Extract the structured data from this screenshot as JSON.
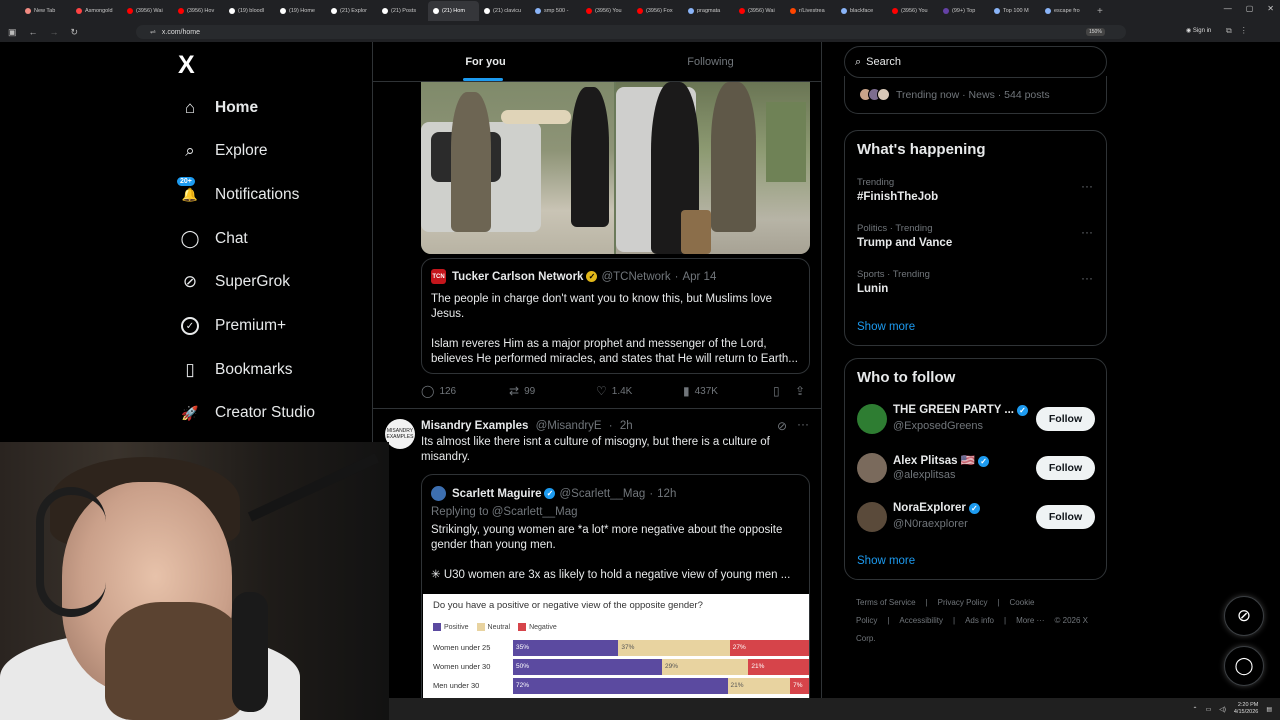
{
  "browser": {
    "tabs": [
      {
        "label": "New Tab",
        "color": "#f28b82"
      },
      {
        "label": "Asmongold",
        "color": "#ff4444"
      },
      {
        "label": "(3956) Wai",
        "color": "#ff0000"
      },
      {
        "label": "(3956) Hov",
        "color": "#ff0000"
      },
      {
        "label": "(19) bloodl",
        "color": "#ffffff"
      },
      {
        "label": "(19) Home",
        "color": "#ffffff"
      },
      {
        "label": "(21) Explor",
        "color": "#ffffff"
      },
      {
        "label": "(21) Posts",
        "color": "#ffffff"
      },
      {
        "label": "(21) Hom",
        "color": "#ffffff",
        "active": true
      },
      {
        "label": "(21) clavicu",
        "color": "#ffffff"
      },
      {
        "label": "smp 500 -",
        "color": "#8ab4f8"
      },
      {
        "label": "(3956) You",
        "color": "#ff0000"
      },
      {
        "label": "(3956) Fox",
        "color": "#ff0000"
      },
      {
        "label": "pragmata",
        "color": "#8ab4f8"
      },
      {
        "label": "(3956) Wai",
        "color": "#ff0000"
      },
      {
        "label": "r/Livestrea",
        "color": "#ff4500"
      },
      {
        "label": "blackface",
        "color": "#8ab4f8"
      },
      {
        "label": "(3956) You",
        "color": "#ff0000"
      },
      {
        "label": "(99+) Top",
        "color": "#6441a5"
      },
      {
        "label": "Top 100 M",
        "color": "#8ab4f8"
      },
      {
        "label": "escape fro",
        "color": "#8ab4f8"
      }
    ],
    "url": "x.com/home",
    "zoom": "150%",
    "signin": "Sign in"
  },
  "nav": {
    "logo": "X",
    "items": [
      {
        "label": "Home",
        "icon": "⌂"
      },
      {
        "label": "Explore",
        "icon": "⌕"
      },
      {
        "label": "Notifications",
        "icon": "🔔"
      },
      {
        "label": "Chat",
        "icon": "◯"
      },
      {
        "label": "SuperGrok",
        "icon": "⊘"
      },
      {
        "label": "Premium+",
        "icon": "✓"
      },
      {
        "label": "Bookmarks",
        "icon": "▯"
      },
      {
        "label": "Creator Studio",
        "icon": "🚀"
      }
    ],
    "notif_badge": "20+"
  },
  "feed": {
    "tabs": [
      "For you",
      "Following"
    ],
    "post1": {
      "quote": {
        "avatar_text": "TCN",
        "name": "Tucker Carlson Network",
        "handle": "@TCNetwork",
        "date": "Apr 14",
        "text1": "The people in charge don't want you to know this, but Muslims love Jesus.",
        "text2": "Islam reveres Him as a major prophet and messenger of the Lord, believes He performed miracles, and states that He will return to Earth..."
      },
      "actions": {
        "replies": "126",
        "reposts": "99",
        "likes": "1.4K",
        "views": "437K"
      }
    },
    "post2": {
      "avatar_text": "MISANDRY EXAMPLES",
      "name": "Misandry Examples",
      "handle": "@MisandryE",
      "time": "2h",
      "text": "Its almost like there isnt a culture of misogny, but there is a culture of misandry.",
      "quote": {
        "name": "Scarlett Maguire",
        "handle": "@Scarlett__Mag",
        "time": "12h",
        "replying": "Replying to @Scarlett__Mag",
        "text1": "Strikingly, young women are *a lot* more negative about the opposite gender than young men.",
        "text2": "✳ U30 women are 3x as likely to hold a negative view of young men ..."
      }
    }
  },
  "chart_data": {
    "type": "bar",
    "title": "Do you have a positive or negative view of the opposite gender?",
    "categories": [
      "Women under 25",
      "Women under 30",
      "Men under 30"
    ],
    "series": [
      {
        "name": "Positive",
        "color": "#5b4aa0",
        "values": [
          35,
          50,
          72
        ]
      },
      {
        "name": "Neutral",
        "color": "#e8d3a0",
        "values": [
          37,
          29,
          21
        ]
      },
      {
        "name": "Negative",
        "color": "#d6444a",
        "values": [
          27,
          21,
          7
        ]
      }
    ],
    "labels": [
      [
        "35%",
        "37%",
        "27%"
      ],
      [
        "50%",
        "29%",
        "21%"
      ],
      [
        "72%",
        "21%",
        "7%"
      ]
    ]
  },
  "right": {
    "search_placeholder": "Search",
    "trending_now": "Trending now · News · 544 posts",
    "whats_happening": {
      "title": "What's happening",
      "items": [
        {
          "meta": "Trending",
          "name": "#FinishTheJob"
        },
        {
          "meta": "Politics · Trending",
          "name": "Trump and Vance"
        },
        {
          "meta": "Sports · Trending",
          "name": "Lunin"
        }
      ],
      "show_more": "Show more"
    },
    "who_to_follow": {
      "title": "Who to follow",
      "accounts": [
        {
          "name": "THE GREEN PARTY ...",
          "handle": "@ExposedGreens",
          "color": "#2e7d32"
        },
        {
          "name": "Alex Plitsas 🇺🇸",
          "handle": "@alexplitsas",
          "color": "#7a6a5c"
        },
        {
          "name": "NoraExplorer",
          "handle": "@N0raexplorer",
          "color": "#5a4a3a"
        }
      ],
      "follow_label": "Follow",
      "show_more": "Show more"
    },
    "footer": [
      "Terms of Service",
      "|",
      "Privacy Policy",
      "|",
      "Cookie Policy",
      "|",
      "Accessibility",
      "|",
      "Ads info",
      "|",
      "More ···",
      "© 2026 X Corp."
    ]
  },
  "taskbar": {
    "time": "2:20 PM",
    "date": "4/15/2026"
  }
}
